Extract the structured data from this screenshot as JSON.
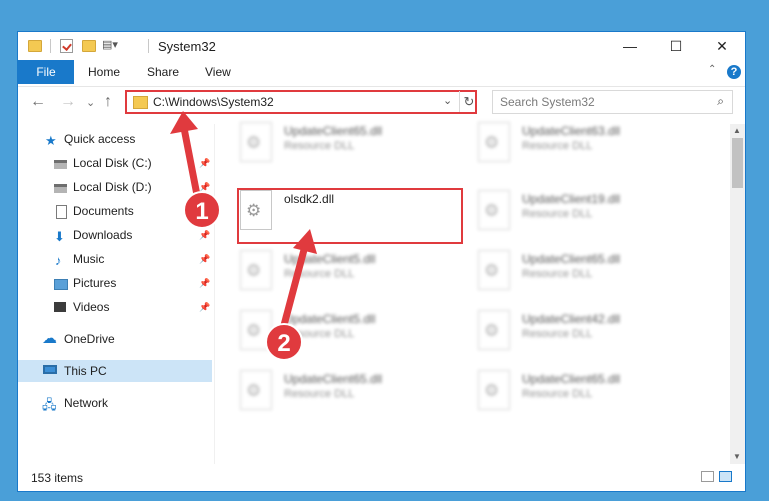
{
  "window": {
    "title": "System32",
    "controls": {
      "minimize": "—",
      "maximize": "☐",
      "close": "✕"
    }
  },
  "ribbon": {
    "tabs": [
      "File",
      "Home",
      "Share",
      "View"
    ],
    "help": "?"
  },
  "navigation": {
    "back": "←",
    "forward": "→",
    "recent": "⌄",
    "up": "↑",
    "address": "C:\\Windows\\System32",
    "refresh": "↻",
    "dropdown": "⌄",
    "search_placeholder": "Search System32",
    "search_icon": "⌕"
  },
  "sidebar": {
    "items": [
      {
        "label": "Quick access",
        "icon": "star-icon"
      },
      {
        "label": "Local Disk (C:)",
        "icon": "disk-icon",
        "pinned": true
      },
      {
        "label": "Local Disk (D:)",
        "icon": "disk-icon",
        "pinned": true
      },
      {
        "label": "Documents",
        "icon": "document-icon",
        "pinned": true
      },
      {
        "label": "Downloads",
        "icon": "download-icon",
        "pinned": true
      },
      {
        "label": "Music",
        "icon": "music-icon",
        "pinned": true
      },
      {
        "label": "Pictures",
        "icon": "picture-icon",
        "pinned": true
      },
      {
        "label": "Videos",
        "icon": "video-icon",
        "pinned": true
      },
      {
        "label": "OneDrive",
        "icon": "cloud-icon"
      },
      {
        "label": "This PC",
        "icon": "pc-icon",
        "selected": true
      },
      {
        "label": "Network",
        "icon": "network-icon"
      }
    ]
  },
  "files": [
    {
      "name": "UpdateClient65.dll",
      "type": "Resource DLL"
    },
    {
      "name": "UpdateClient63.dll",
      "type": "Resource DLL"
    },
    {
      "name": "olsdk2.dll",
      "type": ""
    },
    {
      "name": "UpdateClient19.dll",
      "type": "Resource DLL"
    },
    {
      "name": "UpdateClient5.dll",
      "type": "Resource DLL"
    },
    {
      "name": "UpdateClient65.dll",
      "type": "Resource DLL"
    },
    {
      "name": "UpdateClient5.dll",
      "type": "Resource DLL"
    },
    {
      "name": "UpdateClient42.dll",
      "type": "Resource DLL"
    },
    {
      "name": "UpdateClient65.dll",
      "type": "Resource DLL"
    },
    {
      "name": "UpdateClient65.dll",
      "type": "Resource DLL"
    }
  ],
  "status": {
    "item_count": "153 items"
  },
  "annotations": {
    "callout_1": "1",
    "callout_2": "2"
  },
  "colors": {
    "accent": "#1979ca",
    "highlight": "#e03a3e",
    "background": "#4a9fd8"
  }
}
